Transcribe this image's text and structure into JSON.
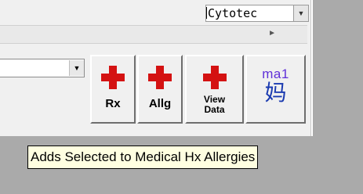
{
  "top_field": {
    "value": "Cytotec"
  },
  "toolbar": {
    "buttons": [
      {
        "label": "Rx",
        "icon": "red-cross-icon"
      },
      {
        "label": "Allg",
        "icon": "red-cross-icon"
      },
      {
        "label_line1": "View",
        "label_line2": "Data",
        "icon": "red-cross-icon"
      },
      {
        "label_top": "ma1",
        "label_char": "妈",
        "icon": "ime-icon"
      }
    ]
  },
  "tooltip": {
    "text": "Adds Selected to Medical Hx Allergies"
  },
  "colors": {
    "cross": "#d41212",
    "tooltip_bg": "#ffffe1",
    "ime_text": "#6030d8"
  }
}
